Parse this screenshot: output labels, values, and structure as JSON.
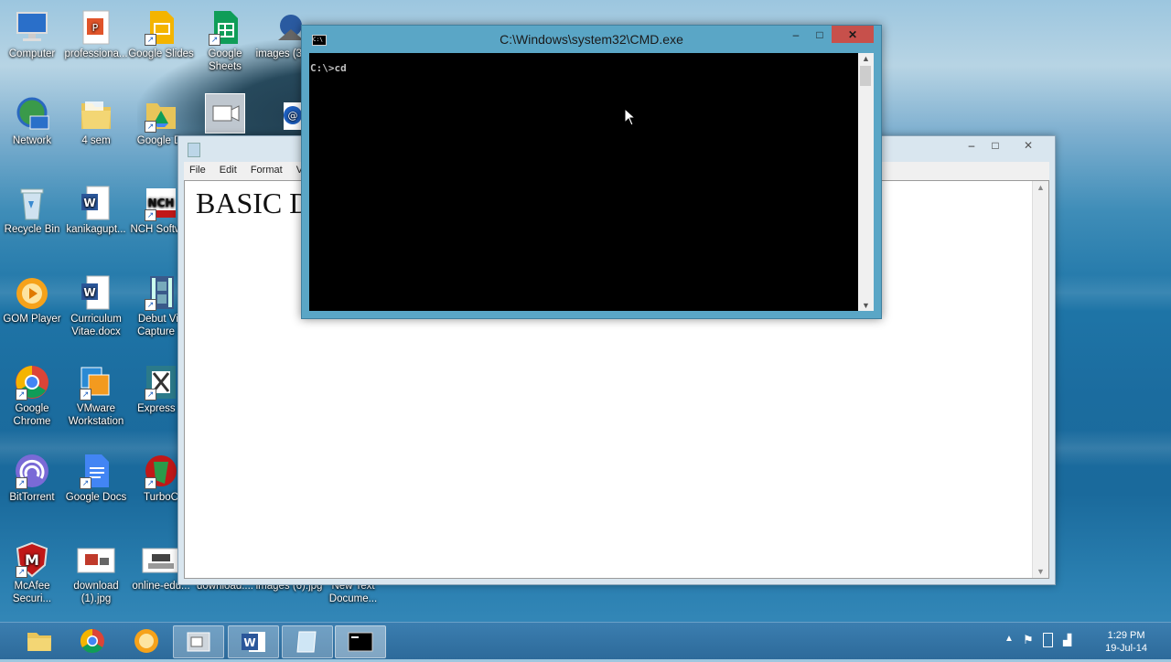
{
  "desktop": {
    "icons": [
      {
        "label": "Computer"
      },
      {
        "label": "professiona..."
      },
      {
        "label": "Google Slides"
      },
      {
        "label": "Google Sheets"
      },
      {
        "label": "images (3).jpg"
      },
      {
        "label": "Network"
      },
      {
        "label": "4 sem"
      },
      {
        "label": "Google Dr"
      },
      {
        "label": "Recycle Bin"
      },
      {
        "label": "kanikagupt..."
      },
      {
        "label": "NCH Softwar"
      },
      {
        "label": "GOM Player"
      },
      {
        "label": "Curriculum Vitae.docx"
      },
      {
        "label": "Debut Vid Capture S"
      },
      {
        "label": "Google Chrome"
      },
      {
        "label": "VMware Workstation"
      },
      {
        "label": "Express Z"
      },
      {
        "label": "BitTorrent"
      },
      {
        "label": "Google Docs"
      },
      {
        "label": "TurboC"
      },
      {
        "label": "McAfee Securi..."
      },
      {
        "label": "download (1).jpg"
      },
      {
        "label": "online-edu..."
      },
      {
        "label": "download...."
      },
      {
        "label": "images (6).jpg"
      },
      {
        "label": "New Text Docume..."
      }
    ]
  },
  "notepad": {
    "menu": [
      "File",
      "Edit",
      "Format",
      "Vi"
    ],
    "text": "BASIC D"
  },
  "cmd": {
    "title": "C:\\Windows\\system32\\CMD.exe",
    "line": "C:\\>cd",
    "icon_text": "C:\\"
  },
  "window_buttons": {
    "minimize": "–",
    "maximize": "□",
    "close": "✕"
  },
  "taskbar": {
    "clock_time": "1:29 PM",
    "clock_date": "19-Jul-14"
  },
  "colors": {
    "cmd_frame": "#5aa6c6",
    "close_button": "#c7504b",
    "taskbar": "#2d6a9a"
  }
}
